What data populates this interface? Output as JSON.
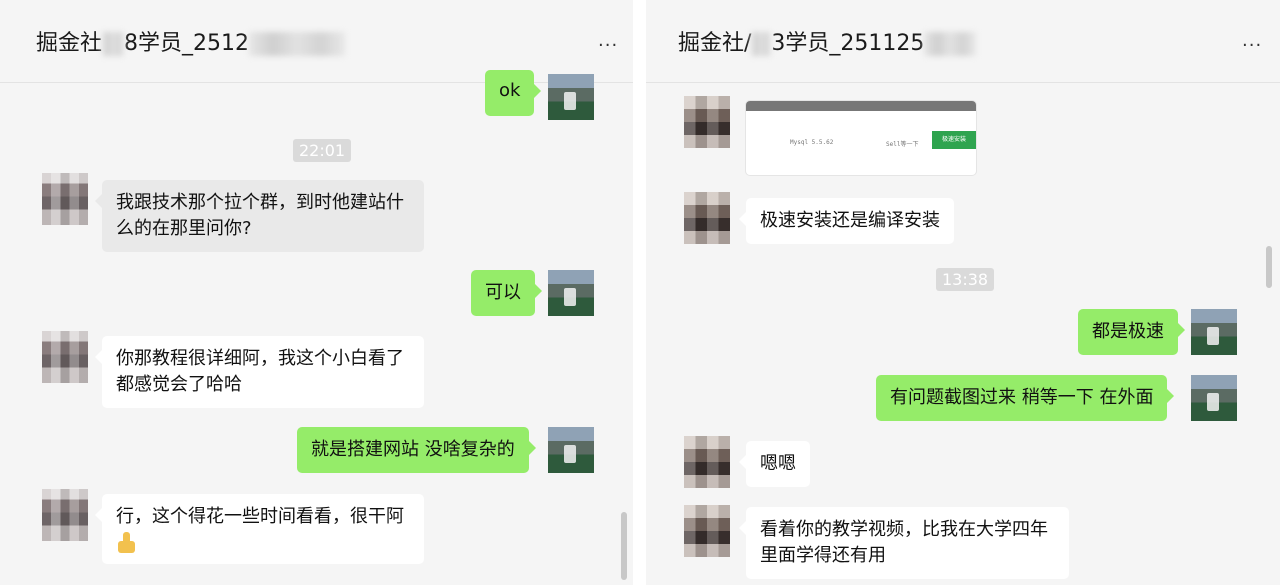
{
  "left": {
    "title": "掘金社",
    "title_suffix": "8学员_2512",
    "more": "...",
    "messages": [
      {
        "side": "sent",
        "text": "ok"
      },
      {
        "side": "time",
        "text": "22:01"
      },
      {
        "side": "recv",
        "lines": [
          "我跟技术那个拉个群，到时他建站什",
          "么的在那里问你?"
        ]
      },
      {
        "side": "sent",
        "text": "可以"
      },
      {
        "side": "recv",
        "lines": [
          "你那教程很详细阿，我这个小白看了",
          "都感觉会了哈哈"
        ]
      },
      {
        "side": "sent",
        "text": "就是搭建网站 没啥复杂的"
      },
      {
        "side": "recv",
        "lines": [
          "行，这个得花一些时间看看，很干阿"
        ]
      }
    ]
  },
  "right": {
    "title": "掘金社/",
    "title_suffix": "3学员_251125",
    "more": "...",
    "screenshot_texts": {
      "left": "Mysql 5.5.62",
      "mid": "Sell等一下",
      "button": "极速安装"
    },
    "messages": [
      {
        "side": "recv",
        "text": "极速安装还是编译安装"
      },
      {
        "side": "time",
        "text": "13:38"
      },
      {
        "side": "sent",
        "text": "都是极速"
      },
      {
        "side": "sent",
        "text": "有问题截图过来  稍等一下 在外面"
      },
      {
        "side": "recv",
        "text": "嗯嗯"
      },
      {
        "side": "recv",
        "lines": [
          "看着你的教学视频，比我在大学四年",
          "里面学得还有用"
        ]
      }
    ]
  },
  "colors": {
    "sent_bubble": "#95ec69",
    "recv_bubble": "#ffffff",
    "panel_bg": "#f5f5f5"
  },
  "icons": [
    "more-icon",
    "thumbs-up-emoji"
  ]
}
